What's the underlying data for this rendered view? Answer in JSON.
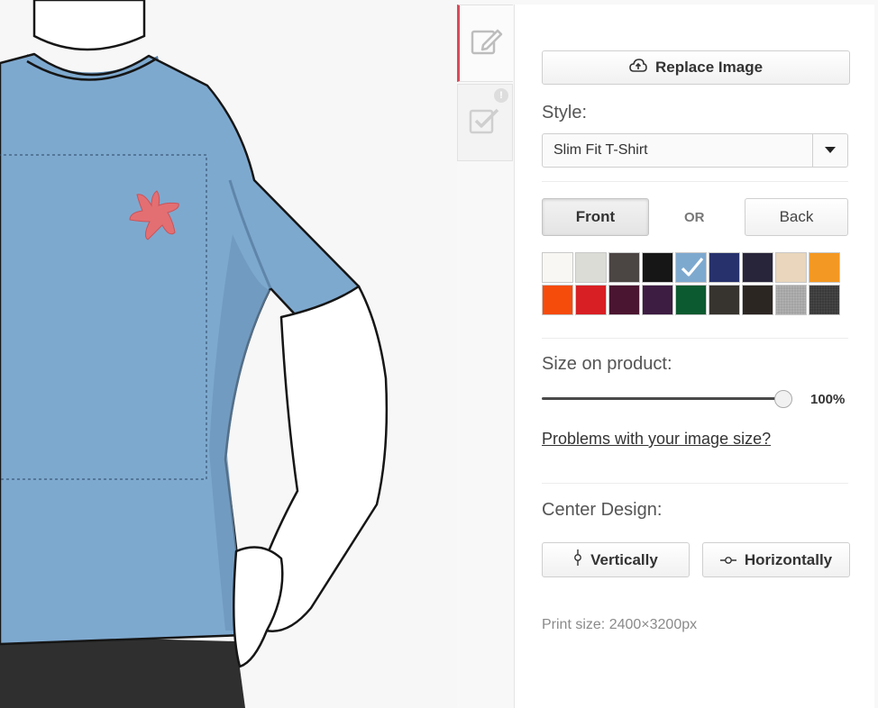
{
  "tabs": [
    {
      "name": "edit",
      "icon": "pencil-icon",
      "active": true
    },
    {
      "name": "review",
      "icon": "check-icon",
      "badge": "!"
    }
  ],
  "panel": {
    "replace_image_label": "Replace Image",
    "style_label": "Style:",
    "style_value": "Slim Fit T-Shirt",
    "front_label": "Front",
    "or_label": "OR",
    "back_label": "Back",
    "swatches": [
      {
        "color": "#f8f7f3"
      },
      {
        "color": "#dcdcd6"
      },
      {
        "color": "#4b4544"
      },
      {
        "color": "#161616"
      },
      {
        "color": "#7ea9cf",
        "selected": true
      },
      {
        "color": "#27326c"
      },
      {
        "color": "#28253b"
      },
      {
        "color": "#e9d6bc"
      },
      {
        "color": "#f39823"
      },
      {
        "color": "#f54b0b"
      },
      {
        "color": "#d81f24"
      },
      {
        "color": "#4a1530"
      },
      {
        "color": "#3d1d42"
      },
      {
        "color": "#0c5a30"
      },
      {
        "color": "#37342f"
      },
      {
        "color": "#2c2623"
      },
      {
        "color": "#a3a3a3"
      },
      {
        "color": "#3a3a3a"
      }
    ],
    "size_label": "Size on product:",
    "size_percent": 100,
    "size_value": "100%",
    "problems_link": "Problems with your image size?",
    "center_label": "Center Design:",
    "vertically_label": "Vertically",
    "horizontally_label": "Horizontally",
    "print_size": "Print size: 2400×3200px"
  },
  "preview": {
    "shirt_color": "#7ea9cf",
    "design": "starfish-icon",
    "design_color": "#e36f73"
  }
}
